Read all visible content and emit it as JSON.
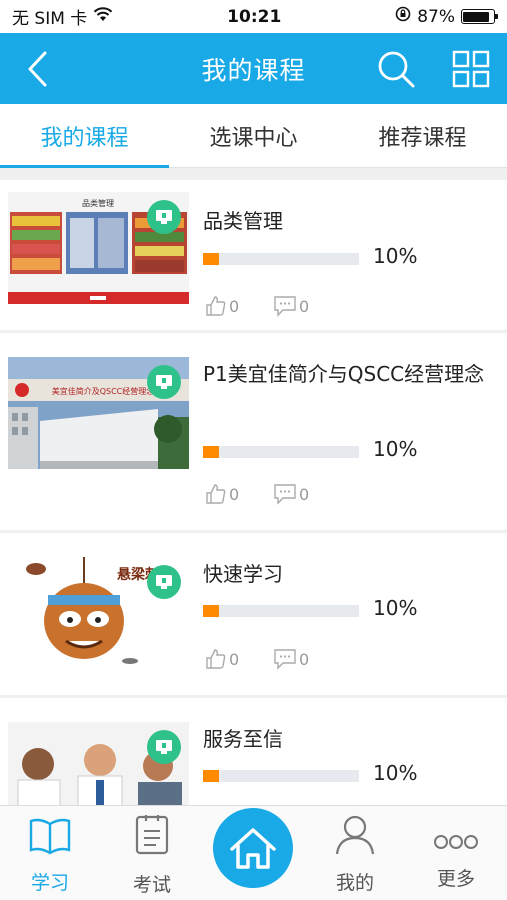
{
  "status_bar": {
    "carrier": "无 SIM 卡",
    "time": "10:21",
    "battery_percent": "87%",
    "battery_level": 0.87
  },
  "header": {
    "title": "我的课程"
  },
  "tabs": [
    {
      "label": "我的课程",
      "active": true
    },
    {
      "label": "选课中心",
      "active": false
    },
    {
      "label": "推荐课程",
      "active": false
    }
  ],
  "courses": [
    {
      "title": "品类管理",
      "progress_text": "10%",
      "progress": 0.1,
      "likes": "0",
      "comments": "0"
    },
    {
      "title": "P1美宜佳简介与QSCC经营理念",
      "progress_text": "10%",
      "progress": 0.1,
      "likes": "0",
      "comments": "0"
    },
    {
      "title": "快速学习",
      "progress_text": "10%",
      "progress": 0.1,
      "likes": "0",
      "comments": "0"
    },
    {
      "title": "服务至信",
      "progress_text": "10%",
      "progress": 0.1
    }
  ],
  "thumbs": {
    "store_sign": "品类管理",
    "building_banner": "美宜佳简介及QSCC经营理念",
    "cartoon_text": "悬梁刺"
  },
  "bottom_nav": [
    {
      "label": "学习",
      "active": true
    },
    {
      "label": "考试",
      "active": false
    },
    {
      "label": "我的",
      "active": false
    },
    {
      "label": "更多",
      "active": false
    }
  ],
  "colors": {
    "primary": "#18a9e6",
    "badge": "#2fc18a",
    "progress": "#ff8a00"
  }
}
